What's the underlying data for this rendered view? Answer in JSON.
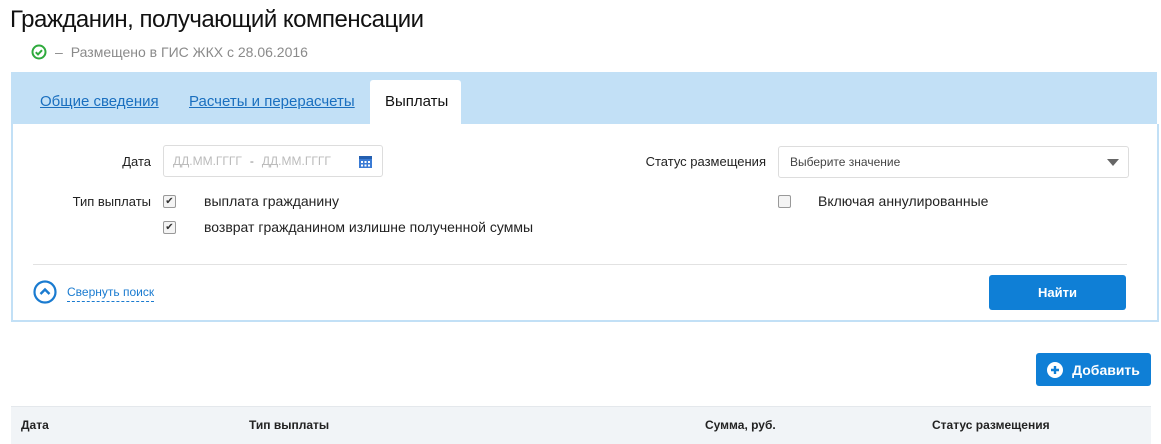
{
  "page_title": "Гражданин, получающий компенсации",
  "status": {
    "dash": "–",
    "text": "Размещено в ГИС ЖКХ с 28.06.2016"
  },
  "tabs": [
    {
      "label": "Общие сведения"
    },
    {
      "label": "Расчеты и перерасчеты"
    },
    {
      "label": "Выплаты"
    }
  ],
  "filters": {
    "date_label": "Дата",
    "date_from_placeholder": "ДД.ММ.ГГГГ",
    "date_sep": "-",
    "date_to_placeholder": "ДД.ММ.ГГГГ",
    "status_label": "Статус размещения",
    "status_placeholder": "Выберите значение",
    "payment_type_label": "Тип выплаты",
    "payment_types": [
      {
        "label": "выплата гражданину",
        "checked": true
      },
      {
        "label": "возврат гражданином излишне полученной суммы",
        "checked": true
      }
    ],
    "include_cancelled": {
      "label": "Включая аннулированные",
      "checked": false
    },
    "collapse_label": "Свернуть поиск",
    "search_button": "Найти"
  },
  "add_button": "Добавить",
  "table": {
    "columns": [
      "Дата",
      "Тип выплаты",
      "Сумма, руб.",
      "Статус размещения"
    ]
  },
  "colors": {
    "accent": "#0f7fd6",
    "tab_bar": "#c2e0f6",
    "ok": "#2eaa3c"
  }
}
